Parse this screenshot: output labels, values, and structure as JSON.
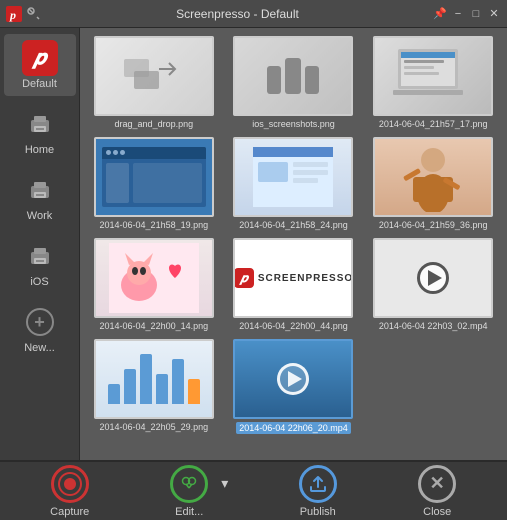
{
  "titlebar": {
    "title": "Screenpresso  -  Default",
    "pin_label": "📌",
    "minimize_label": "−",
    "maximize_label": "□",
    "close_label": "✕"
  },
  "sidebar": {
    "items": [
      {
        "id": "default",
        "label": "Default",
        "icon": "default-icon",
        "active": true
      },
      {
        "id": "home",
        "label": "Home",
        "icon": "printer-icon",
        "active": false
      },
      {
        "id": "work",
        "label": "Work",
        "icon": "printer-icon",
        "active": false
      },
      {
        "id": "ios",
        "label": "iOS",
        "icon": "printer-icon",
        "active": false
      },
      {
        "id": "new",
        "label": "New...",
        "icon": "plus-icon",
        "active": false
      }
    ]
  },
  "grid": {
    "items": [
      {
        "id": 1,
        "label": "drag_and_drop.png",
        "type": "arrows",
        "selected": false
      },
      {
        "id": 2,
        "label": "ios_screenshots.png",
        "type": "phones",
        "selected": false
      },
      {
        "id": 3,
        "label": "2014-06-04_21h57_17.png",
        "type": "laptop",
        "selected": false
      },
      {
        "id": 4,
        "label": "2014-06-04_21h58_19.png",
        "type": "bluescreenshot",
        "selected": false
      },
      {
        "id": 5,
        "label": "2014-06-04_21h58_24.png",
        "type": "screenshot2",
        "selected": false
      },
      {
        "id": 6,
        "label": "2014-06-04_21h59_36.png",
        "type": "person",
        "selected": false
      },
      {
        "id": 7,
        "label": "2014-06-04_22h00_14.png",
        "type": "cartoon",
        "selected": false
      },
      {
        "id": 8,
        "label": "2014-06-04_22h00_44.png",
        "type": "screenpresso",
        "selected": false
      },
      {
        "id": 9,
        "label": "2014-06-04 22h03_02.mp4",
        "type": "video",
        "selected": false
      },
      {
        "id": 10,
        "label": "2014-06-04_22h05_29.png",
        "type": "chart",
        "selected": false
      },
      {
        "id": 11,
        "label": "2014-06-04 22h06_20.mp4",
        "type": "video2",
        "selected": true
      }
    ],
    "chart_bars": [
      20,
      35,
      50,
      30,
      45,
      25
    ]
  },
  "bottombar": {
    "capture_label": "Capture",
    "edit_label": "Edit...",
    "publish_label": "Publish",
    "close_label": "Close"
  }
}
